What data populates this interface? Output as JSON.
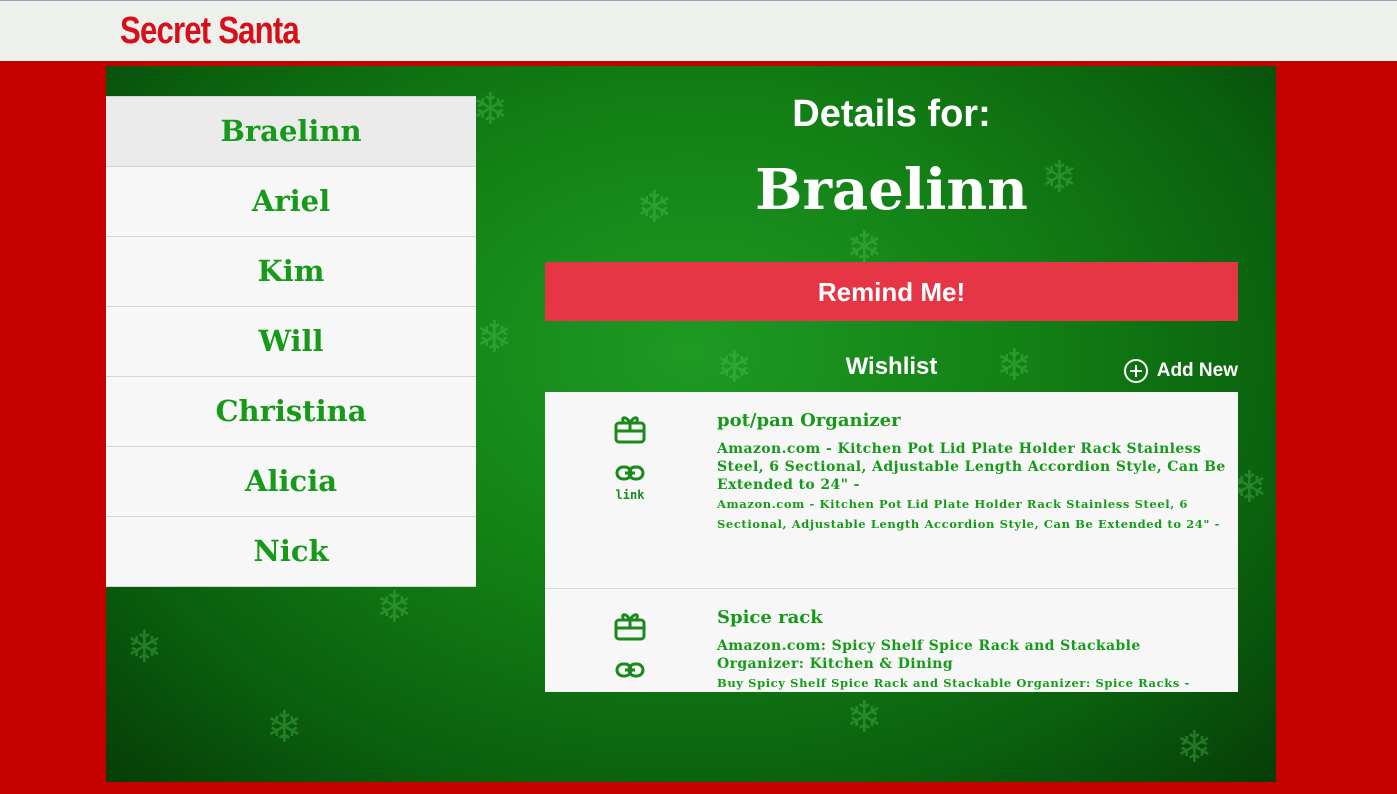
{
  "app": {
    "title": "Secret Santa"
  },
  "names": [
    "Braelinn",
    "Ariel",
    "Kim",
    "Will",
    "Christina",
    "Alicia",
    "Nick"
  ],
  "details": {
    "label": "Details for:",
    "name": "Braelinn",
    "remind_label": "Remind Me!",
    "wishlist_title": "Wishlist",
    "add_new_label": "Add New"
  },
  "wishlist": [
    {
      "name": "pot/pan Organizer",
      "link_label": "link",
      "link_title": "Amazon.com - Kitchen Pot Lid Plate Holder Rack Stainless Steel, 6 Sectional, Adjustable Length Accordion Style, Can Be Extended to 24\" -",
      "description": "Amazon.com - Kitchen Pot Lid Plate Holder Rack Stainless Steel, 6 Sectional, Adjustable Length Accordion Style, Can Be Extended to 24\" -"
    },
    {
      "name": "Spice rack",
      "link_title": "Amazon.com: Spicy Shelf Spice Rack and Stackable Organizer: Kitchen & Dining",
      "description": "Buy Spicy Shelf Spice Rack and Stackable Organizer: Spice Racks -"
    }
  ],
  "icons": {
    "gift": "gift-icon",
    "link": "link-icon",
    "add": "plus-circle-icon"
  },
  "colors": {
    "brand_red": "#d6101b",
    "background_red": "#c40000",
    "accent_green": "#179a1a",
    "remind_red": "#e63645"
  }
}
